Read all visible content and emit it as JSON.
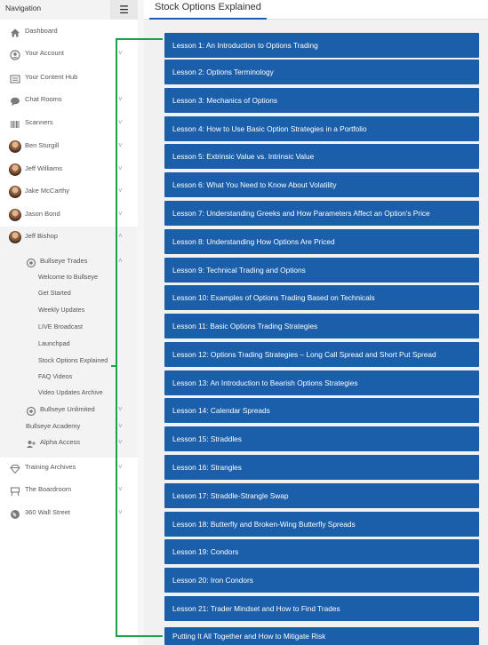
{
  "nav": {
    "title": "Navigation",
    "menu_icon": "hamburger-icon",
    "items": [
      {
        "label": "Dashboard",
        "icon": "home-icon",
        "chevron": false
      },
      {
        "label": "Your Account",
        "icon": "user-circle-icon",
        "chevron": true
      },
      {
        "label": "Your Content Hub",
        "icon": "content-hub-icon",
        "chevron": false
      },
      {
        "label": "Chat Rooms",
        "icon": "chat-bubble-icon",
        "chevron": true
      },
      {
        "label": "Scanners",
        "icon": "barcode-icon",
        "chevron": true
      },
      {
        "label": "Ben Sturgill",
        "icon": "avatar",
        "chevron": true
      },
      {
        "label": "Jeff Williams",
        "icon": "avatar",
        "chevron": true
      },
      {
        "label": "Jake McCarthy",
        "icon": "avatar",
        "chevron": true
      },
      {
        "label": "Jason Bond",
        "icon": "avatar",
        "chevron": true
      },
      {
        "label": "Jeff Bishop",
        "icon": "avatar",
        "chevron": true,
        "expanded": true
      }
    ],
    "bullseye_trades": {
      "label": "Bullseye Trades",
      "children": [
        "Welcome to Bullseye",
        "Get Started",
        "Weekly Updates",
        "LIVE Broadcast",
        "Launchpad",
        "Stock Options Explained",
        "FAQ Videos",
        "Video Updates Archive"
      ]
    },
    "bullseye_unlimited": "Bullseye Unlimited",
    "bullseye_academy": "Bullseye Academy",
    "alpha_access": "Alpha Access",
    "bottom_items": [
      {
        "label": "Training Archives",
        "icon": "diamond-icon"
      },
      {
        "label": "The Boardroom",
        "icon": "boardroom-icon"
      },
      {
        "label": "360 Wall Street",
        "icon": "globe-icon"
      }
    ]
  },
  "main": {
    "tab_title": "Stock Options Explained",
    "lessons": [
      "Lesson 1: An Introduction to Options Trading",
      "Lesson 2: Options Terminology",
      "Lesson 3: Mechanics of Options",
      "Lesson 4: How to Use Basic Option Strategies in a Portfolio",
      "Lesson 5: Extrinsic Value vs. Intrinsic Value",
      "Lesson 6: What You Need to Know About Volatility",
      "Lesson 7: Understanding Greeks and How Parameters Affect an Option's Price",
      "Lesson 8: Understanding How Options Are Priced",
      "Lesson 9: Technical Trading and Options",
      "Lesson 10: Examples of Options Trading Based on Technicals",
      "Lesson 11: Basic Options Trading Strategies",
      "Lesson 12: Options Trading Strategies – Long Call Spread and Short Put Spread",
      "Lesson 13: An Introduction to Bearish Options Strategies",
      "Lesson 14: Calendar Spreads",
      "Lesson 15: Straddles",
      "Lesson 16: Strangles",
      "Lesson 17: Straddle-Strangle Swap",
      "Lesson 18: Butterfly and Broken-Wing Butterfly Spreads",
      "Lesson 19: Condors",
      "Lesson 20: Iron Condors",
      "Lesson 21: Trader Mindset and How to Find Trades",
      "Putting It All Together and How to Mitigate Risk"
    ]
  },
  "colors": {
    "lesson_bg": "#1b5eaa",
    "bracket": "#1aa34a",
    "tab_underline": "#1b5faa"
  }
}
